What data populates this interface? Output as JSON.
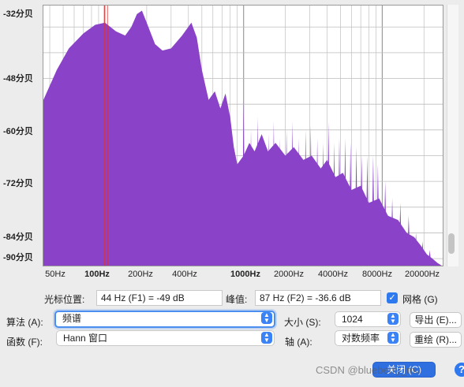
{
  "chart_data": {
    "type": "area",
    "title": "",
    "xlabel": "",
    "ylabel": "",
    "x_scale": "log",
    "x_range_hz": [
      36,
      28000
    ],
    "y_range_db": [
      -92,
      -31
    ],
    "y_tick_labels": [
      "-32分贝",
      "-48分贝",
      "-60分贝",
      "-72分贝",
      "-84分贝",
      "-90分贝"
    ],
    "x_tick_labels": [
      "50Hz",
      "100Hz",
      "200Hz",
      "400Hz",
      "1000Hz",
      "2000Hz",
      "4000Hz",
      "8000Hz",
      "20000Hz"
    ],
    "x_tick_bold": [
      false,
      true,
      false,
      false,
      true,
      false,
      false,
      false,
      false
    ],
    "cursor_hz": 99,
    "fill_color": "#8a42c8",
    "grid": true,
    "envelope": [
      [
        36,
        -53
      ],
      [
        45,
        -46
      ],
      [
        55,
        -41
      ],
      [
        70,
        -37.5
      ],
      [
        85,
        -35.5
      ],
      [
        100,
        -35
      ],
      [
        120,
        -37
      ],
      [
        140,
        -38
      ],
      [
        155,
        -36
      ],
      [
        170,
        -33
      ],
      [
        185,
        -32.2
      ],
      [
        200,
        -35
      ],
      [
        230,
        -40
      ],
      [
        260,
        -41.5
      ],
      [
        300,
        -41
      ],
      [
        360,
        -38
      ],
      [
        420,
        -35
      ],
      [
        460,
        -38.5
      ],
      [
        500,
        -46
      ],
      [
        560,
        -53
      ],
      [
        620,
        -51
      ],
      [
        680,
        -55
      ],
      [
        740,
        -51.5
      ],
      [
        800,
        -57
      ],
      [
        850,
        -64
      ],
      [
        900,
        -68
      ],
      [
        1000,
        -66
      ],
      [
        1100,
        -63
      ],
      [
        1200,
        -65
      ],
      [
        1350,
        -61
      ],
      [
        1500,
        -65
      ],
      [
        1700,
        -63
      ],
      [
        2000,
        -66
      ],
      [
        2300,
        -64
      ],
      [
        2700,
        -67
      ],
      [
        3100,
        -66
      ],
      [
        3600,
        -69
      ],
      [
        4000,
        -67
      ],
      [
        4600,
        -71
      ],
      [
        5200,
        -70
      ],
      [
        6000,
        -74
      ],
      [
        7000,
        -73
      ],
      [
        8000,
        -77
      ],
      [
        9500,
        -76
      ],
      [
        11000,
        -80
      ],
      [
        13000,
        -81
      ],
      [
        15000,
        -84
      ],
      [
        17000,
        -85
      ],
      [
        19000,
        -87
      ],
      [
        21000,
        -89
      ],
      [
        23000,
        -90
      ],
      [
        25000,
        -91
      ],
      [
        28000,
        -92
      ]
    ],
    "spikes": [
      [
        1000,
        -53
      ],
      [
        1130,
        -60
      ],
      [
        1260,
        -57
      ],
      [
        1520,
        -61
      ],
      [
        1650,
        -58
      ],
      [
        1820,
        -62
      ],
      [
        2040,
        -60
      ],
      [
        2250,
        -58
      ],
      [
        2500,
        -62
      ],
      [
        2800,
        -60
      ],
      [
        3050,
        -59
      ],
      [
        3400,
        -62
      ],
      [
        3750,
        -63
      ],
      [
        4100,
        -58
      ],
      [
        4500,
        -63
      ],
      [
        4900,
        -62
      ],
      [
        5400,
        -62
      ],
      [
        5900,
        -63
      ],
      [
        6500,
        -64
      ],
      [
        7100,
        -66
      ],
      [
        7800,
        -66
      ],
      [
        8600,
        -66
      ],
      [
        9300,
        -68
      ],
      [
        10500,
        -72
      ],
      [
        11800,
        -76
      ],
      [
        13500,
        -77
      ],
      [
        15500,
        -80
      ],
      [
        17500,
        -84
      ],
      [
        19500,
        -86
      ],
      [
        22000,
        -88
      ]
    ]
  },
  "controls": {
    "cursor_label": "光标位置:",
    "cursor_value": "44 Hz (F1) = -49 dB",
    "peak_label": "峰值:",
    "peak_value": "87 Hz (F2) = -36.6 dB",
    "grid_label": "网格 (G)",
    "grid_checked": true,
    "algorithm_label": "算法 (A):",
    "algorithm_value": "频谱",
    "function_label": "函数 (F):",
    "function_value": "Hann 窗口",
    "size_label": "大小 (S):",
    "size_value": "1024",
    "axis_label": "轴 (A):",
    "axis_value": "对数频率",
    "export_button": "导出 (E)...",
    "replot_button": "重绘 (R)...",
    "close_button": "关闭 (C)",
    "help_button": "?"
  },
  "watermark": "CSDN @blueberry_mu"
}
